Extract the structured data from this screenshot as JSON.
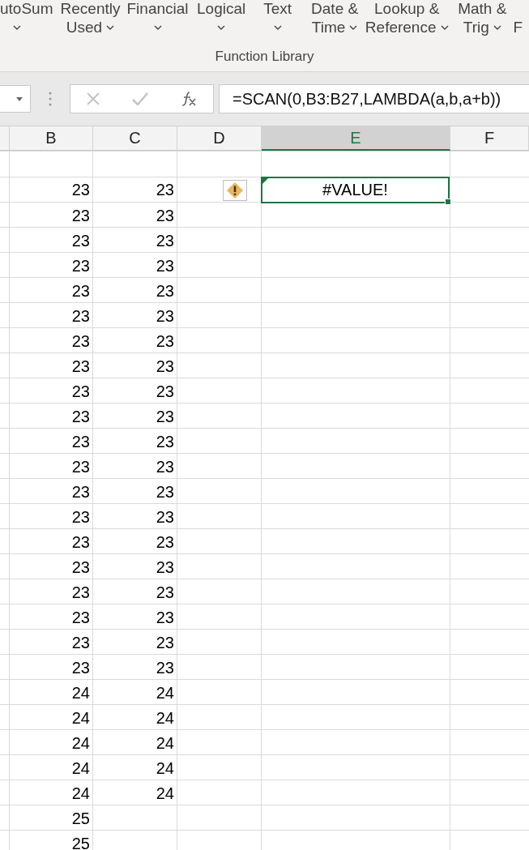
{
  "ribbon": {
    "buttons": [
      {
        "line1": "utoSum",
        "dropdown": true
      },
      {
        "line1": "Recently",
        "line2": "Used",
        "dropdown": true
      },
      {
        "line1": "Financial",
        "dropdown": true
      },
      {
        "line1": "Logical",
        "dropdown": true
      },
      {
        "line1": "Text",
        "dropdown": true
      },
      {
        "line1": "Date &",
        "line2": "Time",
        "dropdown": true
      },
      {
        "line1": "Lookup &",
        "line2": "Reference",
        "dropdown": true
      },
      {
        "line1": "Math &",
        "line2": "Trig",
        "dropdown": true
      },
      {
        "line2": "F",
        "dropdown": false
      }
    ],
    "group_label": "Function Library"
  },
  "formula_bar": {
    "formula": "=SCAN(0,B3:B27,LAMBDA(a,b,a+b))"
  },
  "columns": [
    {
      "label": "B",
      "selected": false
    },
    {
      "label": "C",
      "selected": false
    },
    {
      "label": "D",
      "selected": false
    },
    {
      "label": "E",
      "selected": true
    },
    {
      "label": "F",
      "selected": false
    }
  ],
  "rows": [
    {
      "active": false,
      "warning": false
    },
    {
      "b": "23",
      "c": "23",
      "e": "#VALUE!",
      "active": true,
      "warning": true
    },
    {
      "b": "23",
      "c": "23",
      "active": false,
      "warning": false
    },
    {
      "b": "23",
      "c": "23",
      "active": false,
      "warning": false
    },
    {
      "b": "23",
      "c": "23",
      "active": false,
      "warning": false
    },
    {
      "b": "23",
      "c": "23",
      "active": false,
      "warning": false
    },
    {
      "b": "23",
      "c": "23",
      "active": false,
      "warning": false
    },
    {
      "b": "23",
      "c": "23",
      "active": false,
      "warning": false
    },
    {
      "b": "23",
      "c": "23",
      "active": false,
      "warning": false
    },
    {
      "b": "23",
      "c": "23",
      "active": false,
      "warning": false
    },
    {
      "b": "23",
      "c": "23",
      "active": false,
      "warning": false
    },
    {
      "b": "23",
      "c": "23",
      "active": false,
      "warning": false
    },
    {
      "b": "23",
      "c": "23",
      "active": false,
      "warning": false
    },
    {
      "b": "23",
      "c": "23",
      "active": false,
      "warning": false
    },
    {
      "b": "23",
      "c": "23",
      "active": false,
      "warning": false
    },
    {
      "b": "23",
      "c": "23",
      "active": false,
      "warning": false
    },
    {
      "b": "23",
      "c": "23",
      "active": false,
      "warning": false
    },
    {
      "b": "23",
      "c": "23",
      "active": false,
      "warning": false
    },
    {
      "b": "23",
      "c": "23",
      "active": false,
      "warning": false
    },
    {
      "b": "23",
      "c": "23",
      "active": false,
      "warning": false
    },
    {
      "b": "23",
      "c": "23",
      "active": false,
      "warning": false
    },
    {
      "b": "24",
      "c": "24",
      "active": false,
      "warning": false
    },
    {
      "b": "24",
      "c": "24",
      "active": false,
      "warning": false
    },
    {
      "b": "24",
      "c": "24",
      "active": false,
      "warning": false
    },
    {
      "b": "24",
      "c": "24",
      "active": false,
      "warning": false
    },
    {
      "b": "24",
      "c": "24",
      "active": false,
      "warning": false
    },
    {
      "b": "25",
      "active": false,
      "warning": false
    },
    {
      "b": "25",
      "active": false,
      "warning": false
    }
  ]
}
